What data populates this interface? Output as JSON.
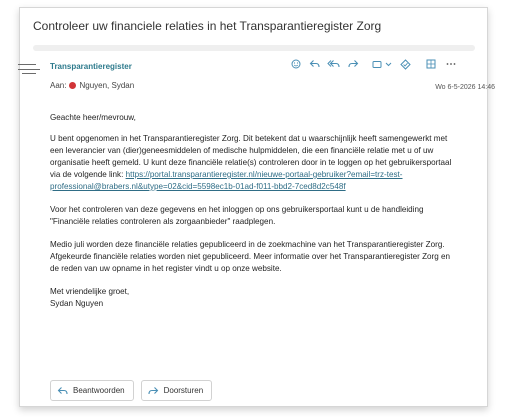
{
  "email": {
    "subject": "Controleer uw financiele relaties in het Transparantieregister Zorg",
    "sender": "Transparantieregister",
    "to_label": "Aan:",
    "to_name": "Nguyen, Sydan",
    "date": "Wo 6-5-2026 14:46"
  },
  "toolbar": {
    "icons": [
      "emoji-icon",
      "reply-icon",
      "reply-all-icon",
      "forward-icon",
      "apps-icon",
      "chevron-down-icon",
      "mark-icon",
      "grid-icon",
      "more-icon"
    ]
  },
  "body": {
    "greeting": "Geachte heer/mevrouw,",
    "para1_text": "U bent opgenomen in het Transparantieregister Zorg. Dit betekent dat u waarschijnlijk heeft samengewerkt met een leverancier van (dier)geneesmiddelen of medische hulpmiddelen, die een financiële relatie met u of uw organisatie heeft gemeld. U kunt deze financiële relatie(s) controleren door in te loggen op het gebruikersportaal via de volgende link: ",
    "link": "https://portal.transparantieregister.nl/nieuwe-portaal-gebruiker?email=trz-test-professional@brabers.nl&utype=02&cid=5598ec1b-01ad-f011-bbd2-7ced8d2c548f",
    "para2": "Voor het controleren van deze gegevens en het inloggen op ons gebruikersportaal kunt u de handleiding \"Financiële relaties controleren als zorgaanbieder\" raadplegen.",
    "para3": "Medio juli worden deze financiële relaties gepubliceerd in de zoekmachine van het Transparantieregister Zorg. Afgekeurde financiële relaties worden niet gepubliceerd. Meer informatie over het Transparantieregister Zorg en de reden van uw opname in het register vindt u op onze website.",
    "closing": "Met vriendelijke groet,",
    "signature": "Sydan Nguyen"
  },
  "actions": {
    "reply_label": "Beantwoorden",
    "forward_label": "Doorsturen"
  },
  "colors": {
    "sender": "#2d7a8c",
    "link": "#2f6d86",
    "presence_dot": "#d13438",
    "icon_accent": "#4a8fb5"
  }
}
